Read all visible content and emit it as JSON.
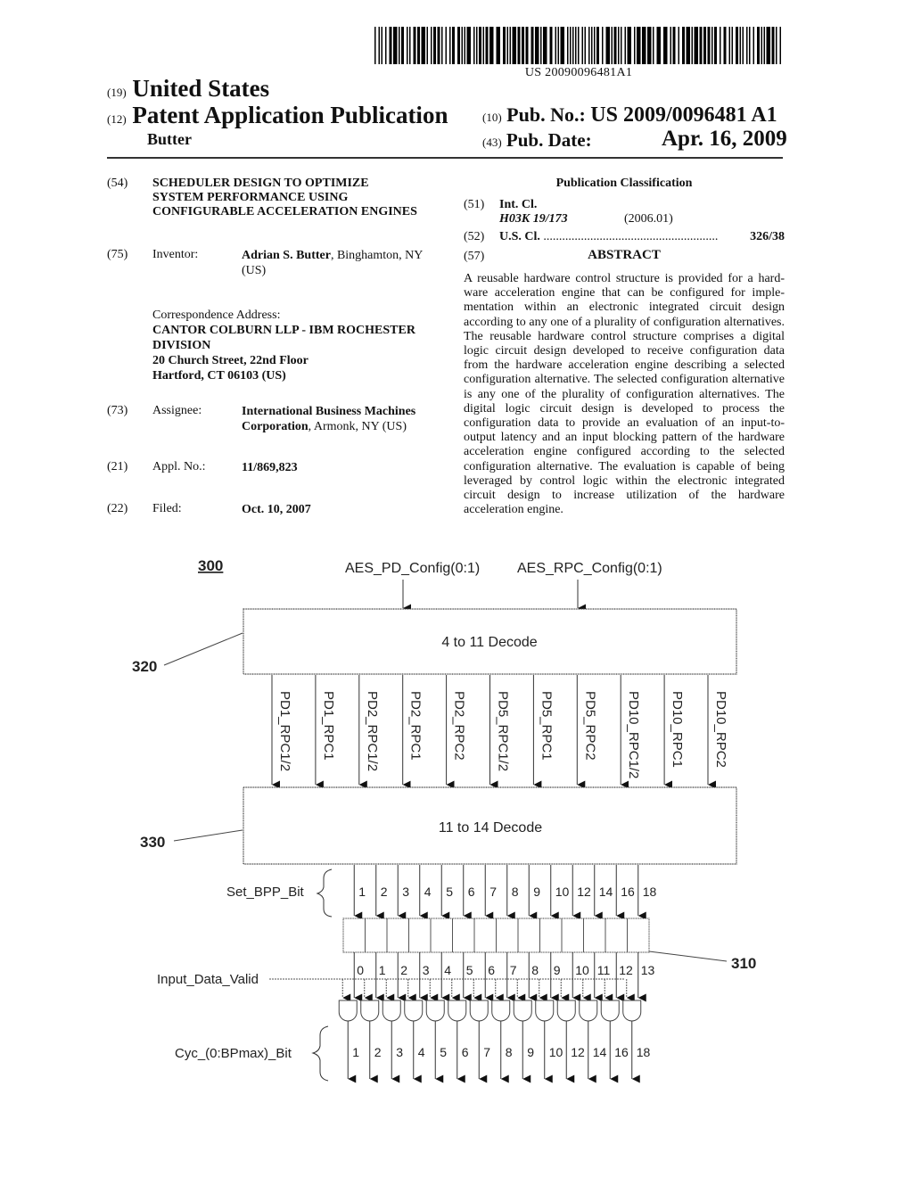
{
  "header": {
    "doc_number": "US 20090096481A1",
    "country_num": "(19)",
    "country": "United States",
    "pub_type_num": "(12)",
    "pub_type": "Patent Application Publication",
    "author": "Butter",
    "pub_no_num": "(10)",
    "pub_no_label": "Pub. No.:",
    "pub_no": "US 2009/0096481 A1",
    "pub_date_num": "(43)",
    "pub_date_label": "Pub. Date:",
    "pub_date": "Apr. 16, 2009"
  },
  "fields": {
    "title": {
      "num": "(54)",
      "lines": [
        "SCHEDULER DESIGN TO OPTIMIZE",
        "SYSTEM PERFORMANCE USING",
        "CONFIGURABLE ACCELERATION ENGINES"
      ]
    },
    "inventor": {
      "num": "(75)",
      "label": "Inventor:",
      "name": "Adrian S. Butter",
      "location": ", Binghamton, NY",
      "location2": "(US)"
    },
    "correspondence": {
      "label": "Correspondence Address:",
      "lines": [
        "CANTOR COLBURN LLP - IBM ROCHESTER",
        "DIVISION",
        "20 Church Street, 22nd Floor",
        "Hartford, CT 06103 (US)"
      ]
    },
    "assignee": {
      "num": "(73)",
      "label": "Assignee:",
      "name1": "International Business Machines",
      "name2": "Corporation",
      "location": ", Armonk, NY (US)"
    },
    "appl_no": {
      "num": "(21)",
      "label": "Appl. No.:",
      "value": "11/869,823"
    },
    "filed": {
      "num": "(22)",
      "label": "Filed:",
      "value": "Oct. 10, 2007"
    }
  },
  "classification": {
    "title": "Publication Classification",
    "int_cl": {
      "num": "(51)",
      "label": "Int. Cl.",
      "code": "H03K 19/173",
      "version": "(2006.01)"
    },
    "us_cl": {
      "num": "(52)",
      "label": "U.S. Cl.",
      "dots": "........................................................",
      "value": "326/38"
    }
  },
  "abstract": {
    "num": "(57)",
    "title": "ABSTRACT",
    "text": "A reusable hardware control structure is provided for a hard­ware acceleration engine that can be configured for imple­mentation within an electronic integrated circuit design according to any one of a plurality of configuration alterna­tives. The reusable hardware control structure comprises a digital logic circuit design developed to receive configuration data from the hardware acceleration engine describing a selected configuration alternative. The selected configuration alternative is any one of the plurality of configuration alter­natives. The digital logic circuit design is developed to pro­cess the configuration data to provide an evaluation of an input-to-output latency and an input blocking pattern of the hardware acceleration engine configured according to the selected configuration alternative. The evaluation is capable of being leveraged by control logic within the electronic integrated circuit design to increase utilization of the hard­ware acceleration engine."
  },
  "diagram": {
    "figure_ref": "300",
    "inputs": [
      "AES_PD_Config(0:1)",
      "AES_RPC_Config(0:1)"
    ],
    "decoder1": {
      "ref": "320",
      "label": "4 to 11 Decode"
    },
    "decoder1_outputs": [
      "PD1_RPC1/2",
      "PD1_RPC1",
      "PD2_RPC1/2",
      "PD2_RPC1",
      "PD2_RPC2",
      "PD5_RPC1/2",
      "PD5_RPC1",
      "PD5_RPC2",
      "PD10_RPC1/2",
      "PD10_RPC1",
      "PD10_RPC2"
    ],
    "decoder2": {
      "ref": "330",
      "label": "11 to 14 Decode"
    },
    "set_bpp_label": "Set_BPP_Bit",
    "set_bpp_bits": [
      "1",
      "2",
      "3",
      "4",
      "5",
      "6",
      "7",
      "8",
      "9",
      "10",
      "12",
      "14",
      "16",
      "18"
    ],
    "register": {
      "ref": "310"
    },
    "register_bits": [
      "0",
      "1",
      "2",
      "3",
      "4",
      "5",
      "6",
      "7",
      "8",
      "9",
      "10",
      "11",
      "12",
      "13"
    ],
    "input_valid_label": "Input_Data_Valid",
    "cyc_label": "Cyc_(0:BPmax)_Bit",
    "cyc_bits": [
      "1",
      "2",
      "3",
      "4",
      "5",
      "6",
      "7",
      "8",
      "9",
      "10",
      "12",
      "14",
      "16",
      "18"
    ]
  }
}
